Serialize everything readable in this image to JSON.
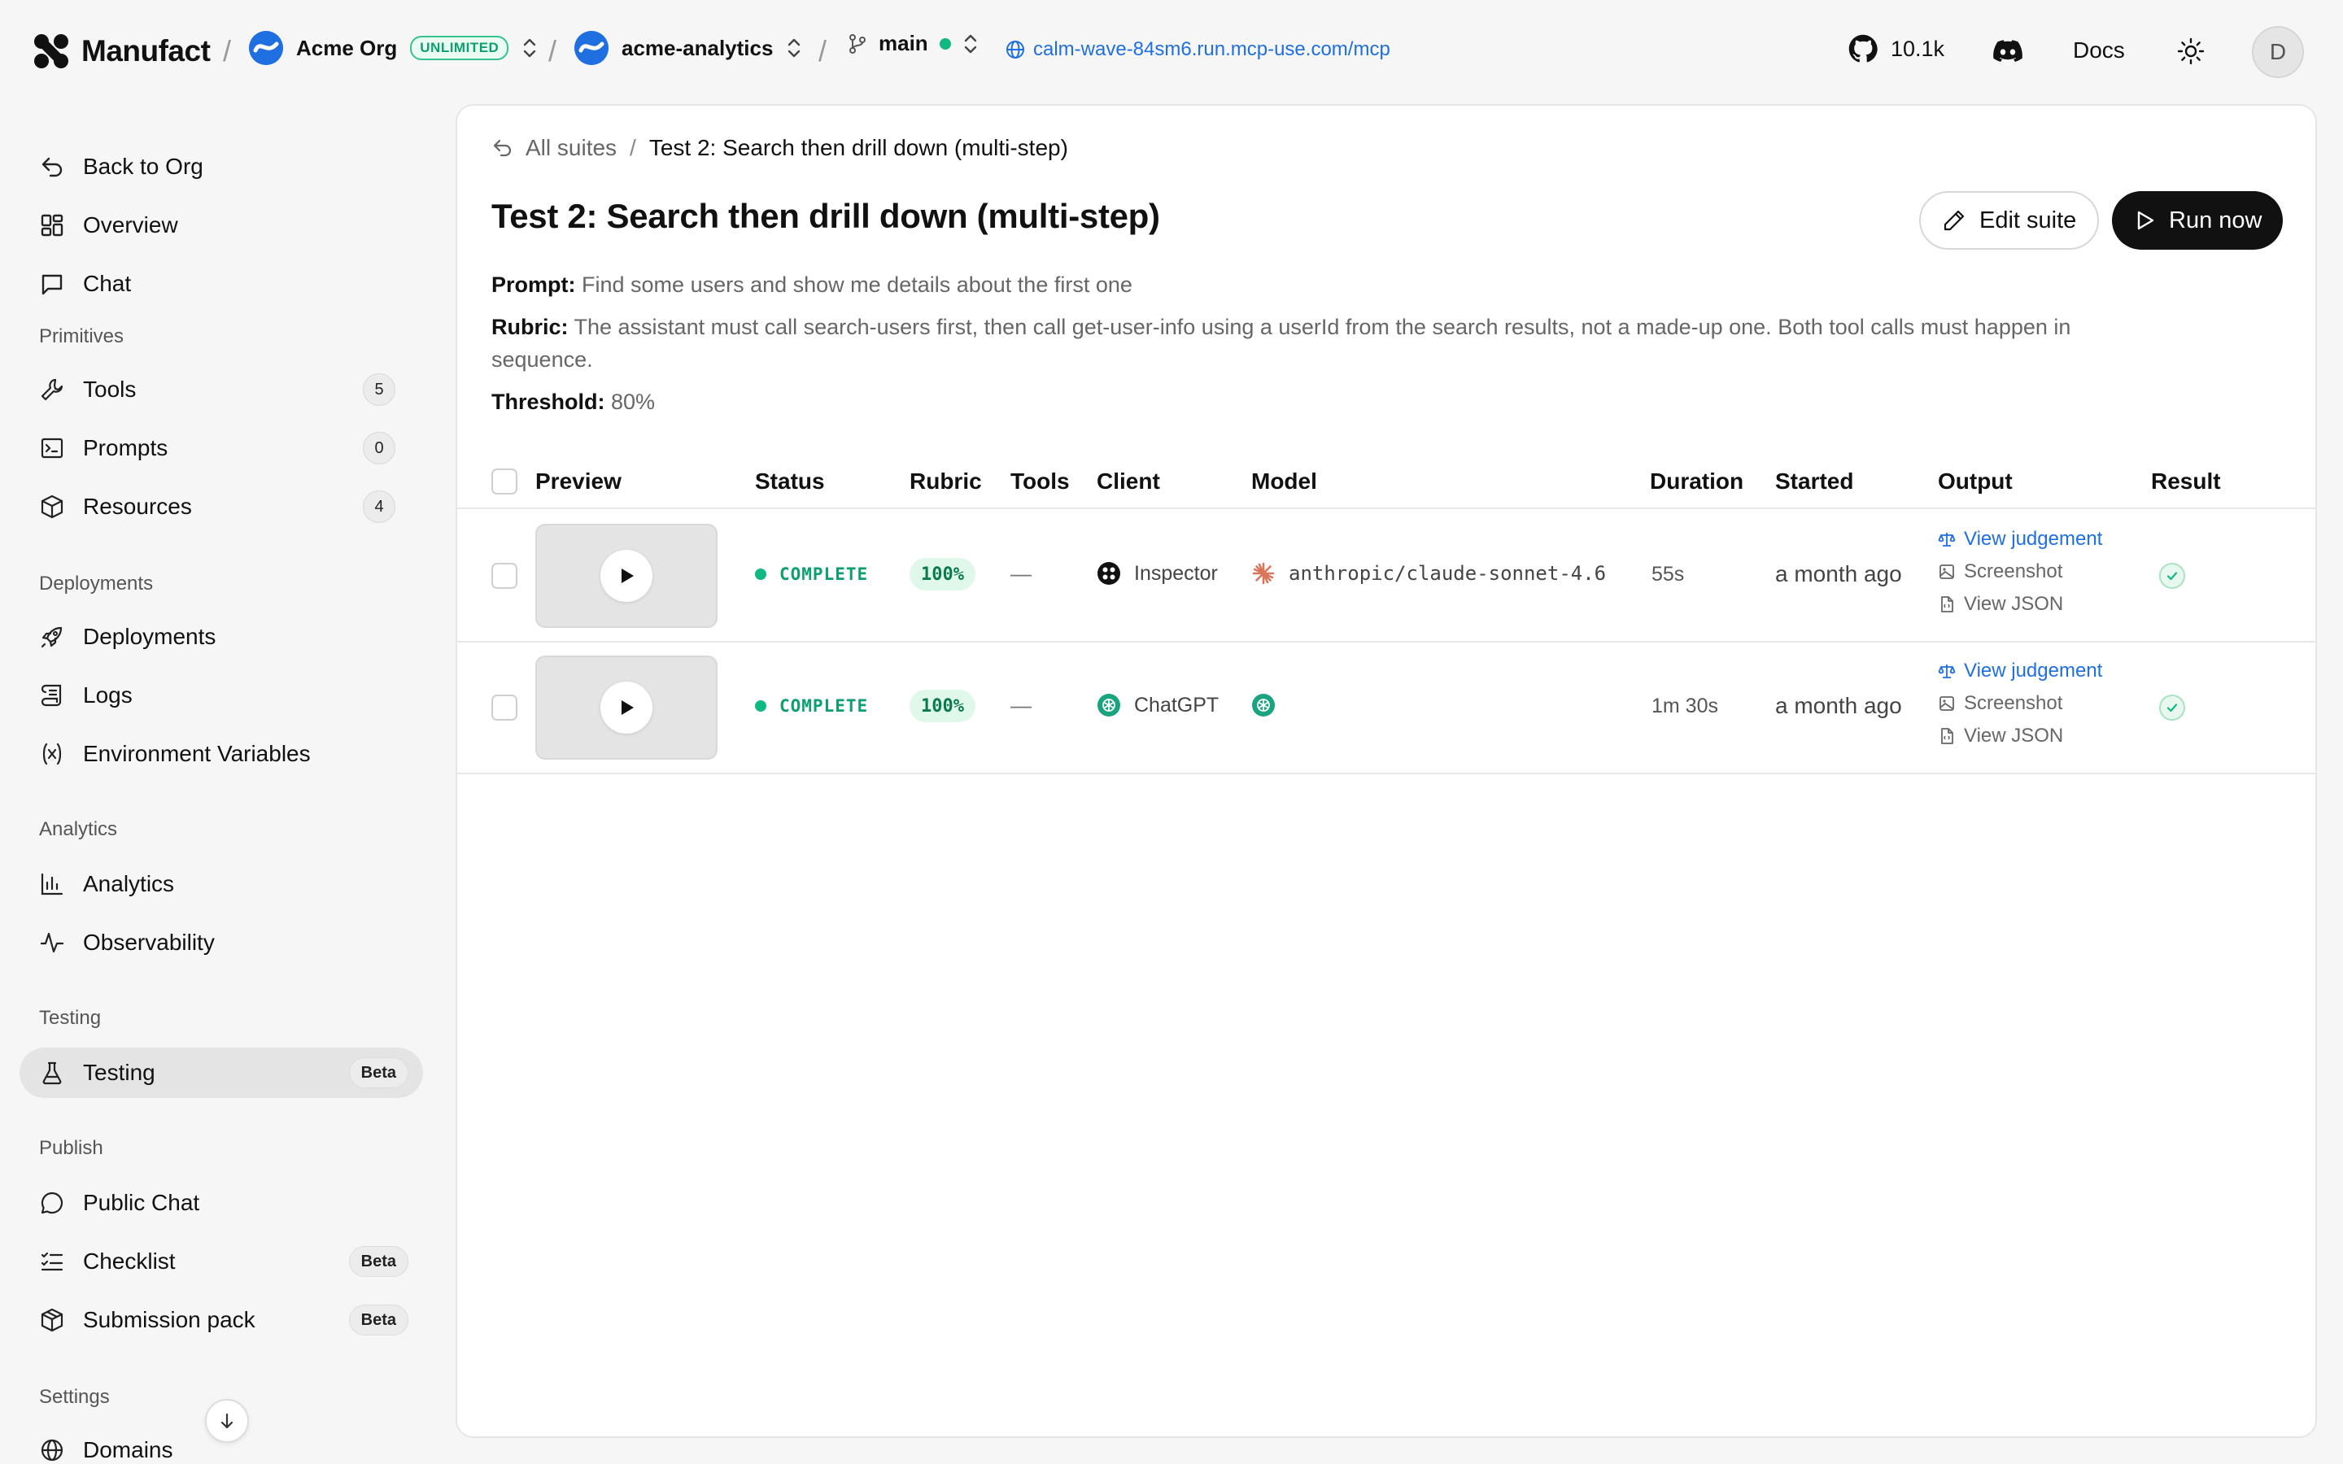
{
  "topbar": {
    "brand": "Manufact",
    "org_name": "Acme Org",
    "org_badge": "UNLIMITED",
    "project_name": "acme-analytics",
    "branch": "main",
    "url": "calm-wave-84sm6.run.mcp-use.com/mcp",
    "github_stars": "10.1k",
    "docs": "Docs",
    "user_initial": "D",
    "separator": "/"
  },
  "sidebar": {
    "top": [
      {
        "label": "Back to Org",
        "icon": "back-arrow-icon"
      },
      {
        "label": "Overview",
        "icon": "grid-icon"
      },
      {
        "label": "Chat",
        "icon": "chat-icon"
      }
    ],
    "sections": {
      "primitives": "Primitives",
      "deployments": "Deployments",
      "analytics": "Analytics",
      "testing": "Testing",
      "publish": "Publish",
      "settings": "Settings"
    },
    "primitives": [
      {
        "label": "Tools",
        "count": "5",
        "icon": "wrench-icon"
      },
      {
        "label": "Prompts",
        "count": "0",
        "icon": "terminal-icon"
      },
      {
        "label": "Resources",
        "count": "4",
        "icon": "cube-icon"
      }
    ],
    "deployments": [
      {
        "label": "Deployments",
        "icon": "rocket-icon"
      },
      {
        "label": "Logs",
        "icon": "scroll-icon"
      },
      {
        "label": "Environment Variables",
        "icon": "variable-icon"
      }
    ],
    "analytics": [
      {
        "label": "Analytics",
        "icon": "bar-chart-icon"
      },
      {
        "label": "Observability",
        "icon": "pulse-icon"
      }
    ],
    "testing": [
      {
        "label": "Testing",
        "badge": "Beta",
        "icon": "flask-icon",
        "active": true
      }
    ],
    "publish": [
      {
        "label": "Public Chat",
        "icon": "chat-bubble-icon"
      },
      {
        "label": "Checklist",
        "badge": "Beta",
        "icon": "checklist-icon"
      },
      {
        "label": "Submission pack",
        "badge": "Beta",
        "icon": "package-icon"
      }
    ],
    "settings": [
      {
        "label": "Domains",
        "icon": "globe-icon"
      }
    ]
  },
  "main": {
    "breadcrumb_back": "All suites",
    "breadcrumb_slash": "/",
    "breadcrumb_current": "Test 2: Search then drill down (multi-step)",
    "title": "Test 2: Search then drill down (multi-step)",
    "edit_label": "Edit suite",
    "run_label": "Run now",
    "prompt_label": "Prompt:",
    "prompt": "Find some users and show me details about the first one",
    "rubric_label": "Rubric:",
    "rubric_line1": "The assistant must call search-users first, then call get-user-info using a userId from the search results, not a made-up one. Both tool calls must happen in",
    "rubric_line2": "sequence.",
    "threshold_label": "Threshold:",
    "threshold": "80%",
    "columns": [
      "Preview",
      "Status",
      "Rubric",
      "Tools",
      "Client",
      "Model",
      "Duration",
      "Started",
      "Output",
      "Result"
    ],
    "rows": [
      {
        "status": "COMPLETE",
        "rubric": "100%",
        "tools": "—",
        "client": "Inspector",
        "model": "anthropic/claude-sonnet-4.6",
        "duration": "55s",
        "started": "a month ago",
        "outputs": [
          "View judgement",
          "Screenshot",
          "View JSON"
        ]
      },
      {
        "status": "COMPLETE",
        "rubric": "100%",
        "tools": "—",
        "client": "ChatGPT",
        "model": "",
        "duration": "1m 30s",
        "started": "a month ago",
        "outputs": [
          "View judgement",
          "Screenshot",
          "View JSON"
        ]
      }
    ]
  },
  "colors": {
    "accent_link": "#1f6fe0",
    "success": "#10b981",
    "primary_button": "#111111"
  }
}
